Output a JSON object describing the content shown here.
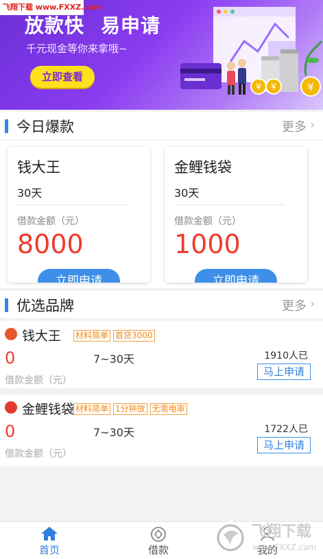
{
  "watermark": "飞翔下载 www.FXXZ.com",
  "banner": {
    "title_a": "放款快",
    "title_b": "易申请",
    "subtitle": "千元现金等你来拿哦~",
    "button": "立即查看"
  },
  "section_hot": {
    "title": "今日爆款",
    "more": "更多"
  },
  "hot_cards": [
    {
      "name": "钱大王",
      "days": "30天",
      "amount_label": "借款金额（元）",
      "amount": "8000",
      "apply": "立即申请"
    },
    {
      "name": "金鲤钱袋",
      "days": "30天",
      "amount_label": "借款金额（元）",
      "amount": "1000",
      "apply": "立即申请"
    }
  ],
  "section_brand": {
    "title": "优选品牌",
    "more": "更多"
  },
  "products": [
    {
      "name": "钱大王",
      "tags": [
        "材料简单",
        "首贷3000"
      ],
      "amount": "0",
      "range": "7~30天",
      "applied": "1910人已",
      "button": "马上申请",
      "amount_label": "借款金额（元）",
      "logo_color": "#e8572a"
    },
    {
      "name": "金鲤钱袋",
      "tags": [
        "材料简单",
        "1分钟放",
        "无需电审"
      ],
      "amount": "0",
      "range": "7~30天",
      "applied": "1722人已",
      "button": "马上申请",
      "amount_label": "借款金额（元）",
      "logo_color": "#e23b2e"
    }
  ],
  "nav": {
    "home": "首页",
    "loan": "借款",
    "mine": "我的"
  },
  "corner_watermark": {
    "text": "飞翔下载",
    "url": "www.FXXZ.com"
  },
  "colors": {
    "accent": "#2f86e8",
    "amount_red": "#ef3b2d",
    "tag_orange": "#f08a18",
    "banner_purple": "#7a35e0"
  }
}
